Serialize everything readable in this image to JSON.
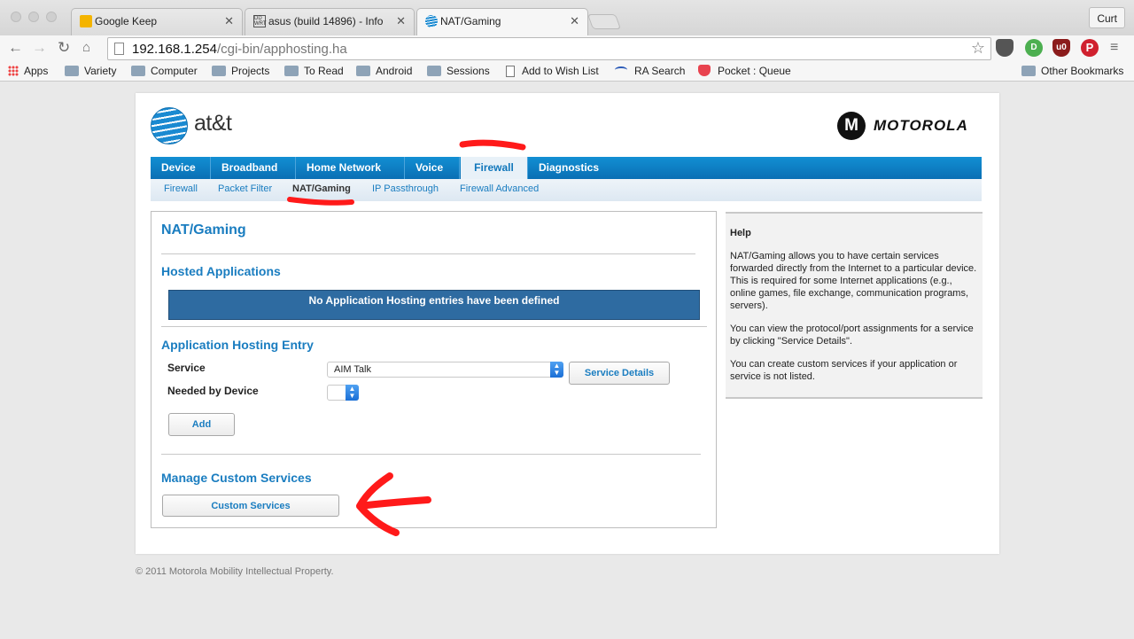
{
  "browser": {
    "tabs": [
      {
        "title": "Google Keep",
        "favicon_color": "#f4b400"
      },
      {
        "title": "asus (build 14896) - Info",
        "favicon_color": "#555555"
      },
      {
        "title": "NAT/Gaming",
        "favicon_color": "#1a8ad1"
      }
    ],
    "profile": "Curt",
    "url_host": "192.168.1.254",
    "url_path": "/cgi-bin/apphosting.ha",
    "bookmarks": [
      {
        "label": "Apps",
        "icon": "apps-icon"
      },
      {
        "label": "Variety",
        "icon": "folder-icon"
      },
      {
        "label": "Computer",
        "icon": "folder-icon"
      },
      {
        "label": "Projects",
        "icon": "folder-icon"
      },
      {
        "label": "To Read",
        "icon": "folder-icon"
      },
      {
        "label": "Android",
        "icon": "folder-icon"
      },
      {
        "label": "Sessions",
        "icon": "folder-icon"
      },
      {
        "label": "Add to Wish List",
        "icon": "doc-icon"
      },
      {
        "label": "RA Search",
        "icon": "ra-icon"
      },
      {
        "label": "Pocket : Queue",
        "icon": "pocket-icon"
      }
    ],
    "other_bookmarks": "Other Bookmarks"
  },
  "header": {
    "att_brand": "at&t",
    "motorola_brand": "MOTOROLA"
  },
  "main_nav": [
    "Device",
    "Broadband",
    "Home Network",
    "Voice",
    "Firewall",
    "Diagnostics"
  ],
  "sub_nav": [
    "Firewall",
    "Packet Filter",
    "NAT/Gaming",
    "IP Passthrough",
    "Firewall Advanced"
  ],
  "content": {
    "title": "NAT/Gaming",
    "hosted_heading": "Hosted Applications",
    "hosted_notice": "No Application Hosting entries have been defined",
    "entry_heading": "Application Hosting Entry",
    "service_label": "Service",
    "service_value": "AIM Talk",
    "service_details_button": "Service Details",
    "device_label": "Needed by Device",
    "device_value": "",
    "add_button": "Add",
    "custom_heading": "Manage Custom Services",
    "custom_button": "Custom Services"
  },
  "help": {
    "title": "Help",
    "p1": "NAT/Gaming allows you to have certain services forwarded directly from the Internet to a particular device. This is required for some Internet applications (e.g., online games, file exchange, communication programs, servers).",
    "p2": "You can view the protocol/port assignments for a service by clicking \"Service Details\".",
    "p3": "You can create custom services if your application or service is not listed."
  },
  "footer": "© 2011 Motorola Mobility Intellectual Property.",
  "colors": {
    "nav_blue": "#0a6fb4",
    "link_blue": "#1a7dc0",
    "annotation_red": "#ff1a1a"
  }
}
